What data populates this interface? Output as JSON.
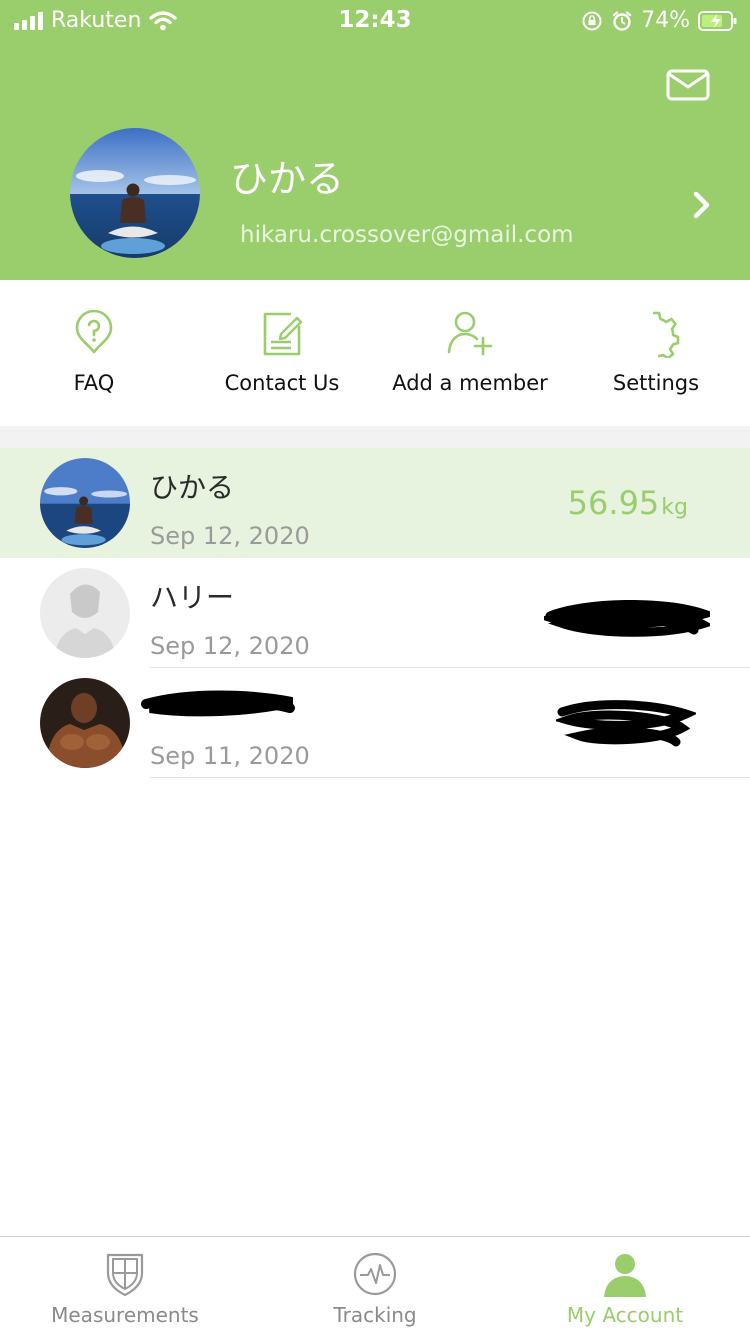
{
  "status_bar": {
    "carrier": "Rakuten",
    "time": "12:43",
    "battery": "74%"
  },
  "profile": {
    "name": "ひかる",
    "email": "hikaru.crossover@gmail.com"
  },
  "quick_actions": [
    {
      "label": "FAQ",
      "icon": "question-bubble-icon"
    },
    {
      "label": "Contact Us",
      "icon": "note-edit-icon"
    },
    {
      "label": "Add a member",
      "icon": "add-person-icon"
    },
    {
      "label": "Settings",
      "icon": "gear-icon"
    }
  ],
  "members": [
    {
      "name": "ひかる",
      "date": "Sep 12, 2020",
      "weight": "56.95",
      "unit": "kg",
      "active": true
    },
    {
      "name": "ハリー",
      "date": "Sep 12, 2020",
      "weight": "",
      "unit": "",
      "active": false
    },
    {
      "name": "",
      "date": "Sep 11, 2020",
      "weight": "",
      "unit": "",
      "active": false
    }
  ],
  "tabs": [
    {
      "label": "Measurements",
      "icon": "shield-icon"
    },
    {
      "label": "Tracking",
      "icon": "heartbeat-icon"
    },
    {
      "label": "My Account",
      "icon": "person-icon",
      "active": true
    }
  ],
  "colors": {
    "accent": "#9acd6b",
    "active_row": "#e8f3df",
    "separator": "#f2f2f2"
  }
}
